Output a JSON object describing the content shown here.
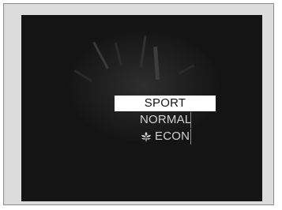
{
  "drive_mode_menu": {
    "items": [
      {
        "label": "SPORT",
        "selected": true
      },
      {
        "label": "NORMAL",
        "selected": false
      },
      {
        "label": "ECON",
        "selected": false,
        "icon": "eco-leaf-icon"
      }
    ]
  },
  "colors": {
    "screen_background": "#141414",
    "selected_background": "#ffffff",
    "selected_text": "#141414",
    "item_text": "#d2d2d2"
  }
}
